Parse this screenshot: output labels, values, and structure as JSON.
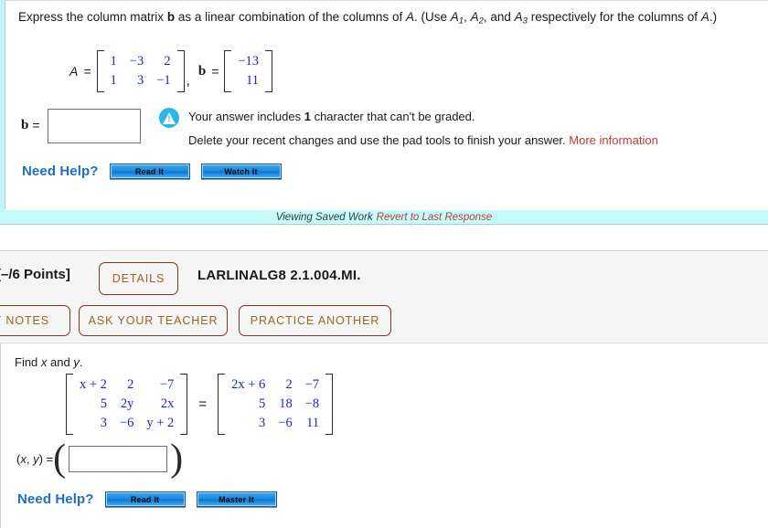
{
  "question1": {
    "prompt_part1": "Express the column matrix ",
    "prompt_b": "b",
    "prompt_part2": " as a linear combination of the columns of ",
    "prompt_A": "A",
    "prompt_part3": ". (Use ",
    "use_A1": "A",
    "use_A1_sub": "1",
    "use_A2": "A",
    "use_A2_sub": "2",
    "use_and": ", and ",
    "use_A3": "A",
    "use_A3_sub": "3",
    "prompt_part4": " respectively for the columns of ",
    "prompt_A2": "A",
    "prompt_part5": ".)",
    "matrix_A_label": "A",
    "matrix_A_eq": "=",
    "matrix_A": [
      [
        "1",
        "−3",
        "2"
      ],
      [
        "1",
        "3",
        "−1"
      ]
    ],
    "comma": ",",
    "matrix_b_label": "b",
    "matrix_b_eq": "=",
    "matrix_b": [
      [
        "−13"
      ],
      [
        "11"
      ]
    ],
    "answer_label": "b",
    "answer_eq": "=",
    "answer_value": "",
    "warning_line1_strong_pre": "Your answer includes ",
    "warning_line1_count": "1",
    "warning_line1_post": " character that can't be graded.",
    "warning_line2": "Delete your recent changes and use the pad tools to finish your answer. ",
    "warning_more_link": "More information",
    "need_help_label": "Need Help?",
    "btn_read_it": "Read It",
    "btn_watch_it": "Watch It"
  },
  "saved_work": {
    "viewing_text": "Viewing Saved Work",
    "revert_link": "Revert to Last Response"
  },
  "question2_header": {
    "points": "[–/6 Points]",
    "details_button": "DETAILS",
    "question_code": "LARLINALG8 2.1.004.MI.",
    "my_notes_button": "Y NOTES",
    "ask_teacher_button": "ASK YOUR TEACHER",
    "practice_another_button": "PRACTICE ANOTHER"
  },
  "question2": {
    "prompt_pre": "Find ",
    "prompt_x": "x",
    "prompt_and": " and ",
    "prompt_y": "y",
    "prompt_post": ".",
    "matrix_left": [
      [
        "x + 2",
        "2",
        "−7"
      ],
      [
        "5",
        "2y",
        "2x"
      ],
      [
        "3",
        "−6",
        "y + 2"
      ]
    ],
    "equals": "=",
    "matrix_right": [
      [
        "2x + 6",
        "2",
        "−7"
      ],
      [
        "5",
        "18",
        "−8"
      ],
      [
        "3",
        "−6",
        "11"
      ]
    ],
    "answer_label_open": "(",
    "answer_label_x": "x",
    "answer_label_comma": ", ",
    "answer_label_y": "y",
    "answer_label_close": ") = ",
    "answer_value": "",
    "paren_open": "(",
    "paren_close": ")",
    "need_help_label": "Need Help?",
    "btn_read_it": "Read It",
    "btn_master_it": "Master It"
  },
  "colors": {
    "matrix_blue": "#2222cc",
    "link_red": "#c23b34",
    "banner_cyan": "#c6fbfb",
    "button_brown": "#7a3428",
    "button_text_gold": "#9a6521",
    "help_blue": "#1d6fc4"
  }
}
